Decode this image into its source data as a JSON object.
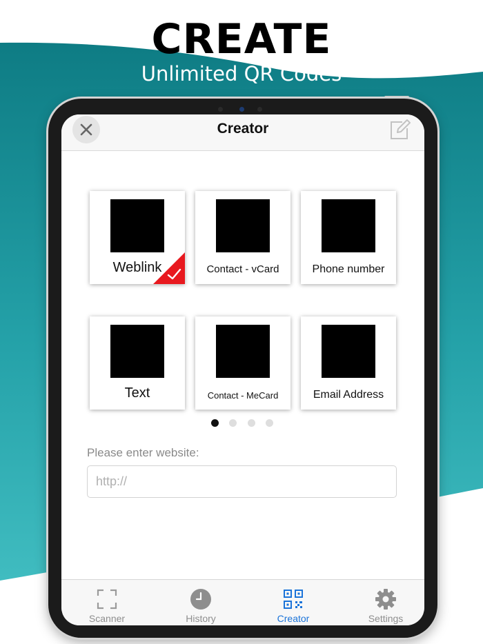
{
  "promo": {
    "title": "CREATE",
    "subtitle": "Unlimited QR Codes"
  },
  "colors": {
    "teal_dark": "#127f86",
    "teal_light": "#3bb4b9",
    "accent_blue": "#1a73d9",
    "selected_red": "#e8191f"
  },
  "navbar": {
    "title": "Creator",
    "close_icon": "close-icon",
    "edit_icon": "compose-icon"
  },
  "types": [
    {
      "label": "Weblink",
      "selected": true
    },
    {
      "label": "Contact - vCard",
      "selected": false
    },
    {
      "label": "Phone number",
      "selected": false
    },
    {
      "label": "Text",
      "selected": false
    },
    {
      "label": "Contact - MeCard",
      "selected": false
    },
    {
      "label": "Email Address",
      "selected": false
    }
  ],
  "pagination": {
    "pages": 4,
    "current": 1
  },
  "form": {
    "label": "Please enter website:",
    "placeholder": "http://",
    "value": ""
  },
  "tabs": [
    {
      "label": "Scanner",
      "icon": "scan-frame-icon",
      "active": false
    },
    {
      "label": "History",
      "icon": "clock-icon",
      "active": false
    },
    {
      "label": "Creator",
      "icon": "qr-code-icon",
      "active": true
    },
    {
      "label": "Settings",
      "icon": "gear-icon",
      "active": false
    }
  ]
}
